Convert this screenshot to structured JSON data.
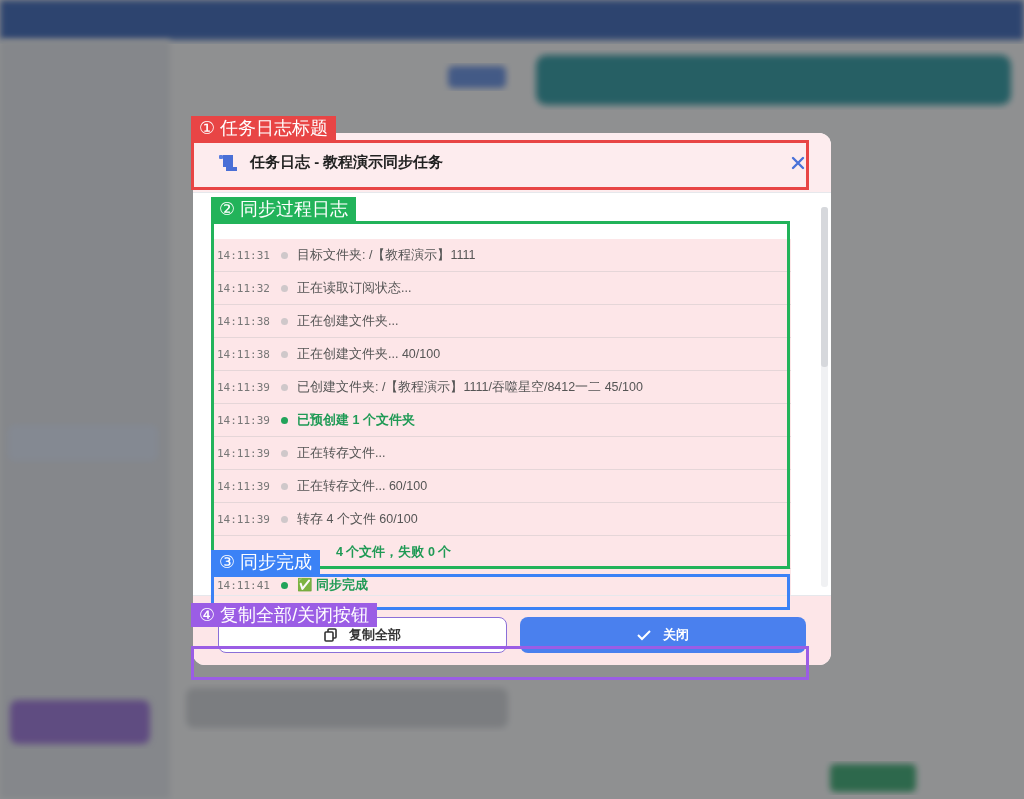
{
  "dialog": {
    "title": "任务日志 - 教程演示同步任务",
    "log": [
      {
        "time": "14:11:31",
        "text": "目标文件夹: /【教程演示】1111",
        "success": false
      },
      {
        "time": "14:11:32",
        "text": "正在读取订阅状态...",
        "success": false
      },
      {
        "time": "14:11:38",
        "text": "正在创建文件夹...",
        "success": false
      },
      {
        "time": "14:11:38",
        "text": "正在创建文件夹... 40/100",
        "success": false
      },
      {
        "time": "14:11:39",
        "text": "已创建文件夹: /【教程演示】1111/吞噬星空/8412一二 45/100",
        "success": false
      },
      {
        "time": "14:11:39",
        "text": "已预创建 1 个文件夹",
        "success": true
      },
      {
        "time": "14:11:39",
        "text": "正在转存文件...",
        "success": false
      },
      {
        "time": "14:11:39",
        "text": "正在转存文件... 60/100",
        "success": false
      },
      {
        "time": "14:11:39",
        "text": "转存 4 个文件 60/100",
        "success": false
      },
      {
        "text": "4 个文件，失败 0 个",
        "success": true
      },
      {
        "time": "14:11:41",
        "text": "✅ 同步完成",
        "success": true
      }
    ],
    "buttons": [
      {
        "label": "复制全部",
        "kind": "copy"
      },
      {
        "label": "关闭",
        "kind": "close"
      }
    ]
  },
  "annotations": [
    {
      "label": "① 任务日志标题",
      "color": "#e84545"
    },
    {
      "label": "② 同步过程日志",
      "color": "#22b35a"
    },
    {
      "label": "③ 同步完成",
      "color": "#3b82f6"
    },
    {
      "label": "④ 复制全部/关闭按钮",
      "color": "#9b5de5"
    }
  ]
}
